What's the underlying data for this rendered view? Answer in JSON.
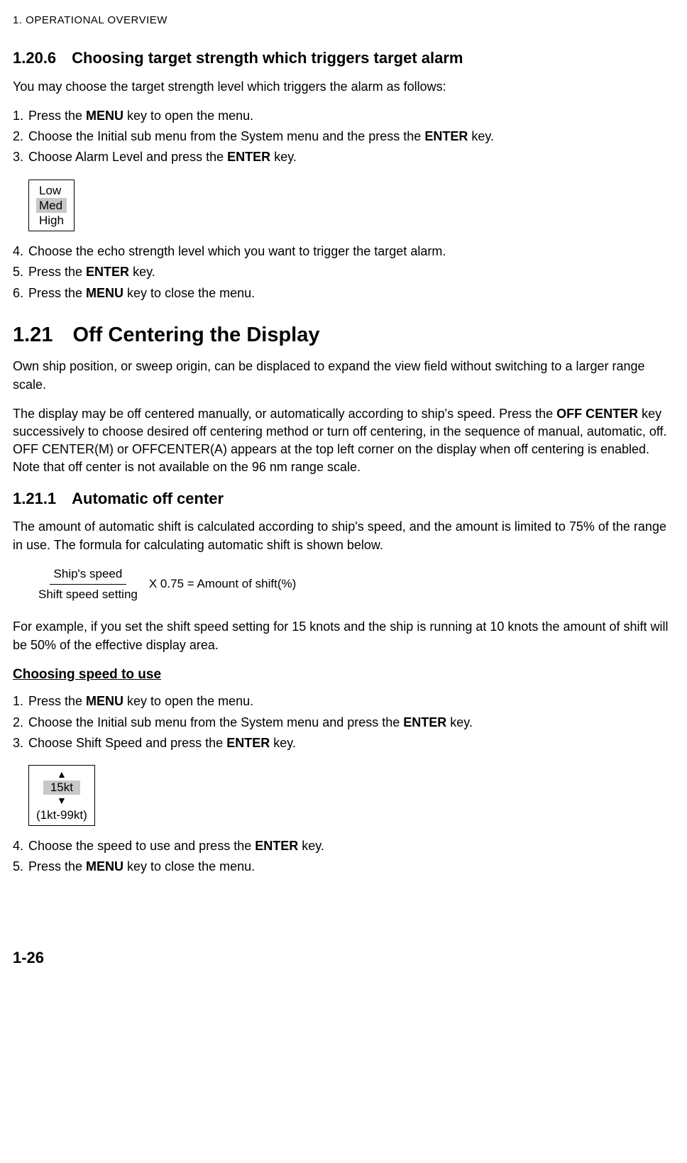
{
  "header": "1. OPERATIONAL OVERVIEW",
  "s1206": {
    "num": "1.20.6",
    "title": "Choosing target strength which triggers target alarm",
    "intro": "You may choose the target strength level which triggers the alarm as follows:",
    "steps_a": [
      {
        "pre": "Press the ",
        "b": "MENU",
        "post": " key to open the menu."
      },
      {
        "pre": "Choose the Initial sub menu from the System menu and the press the ",
        "b": "ENTER",
        "post": " key."
      },
      {
        "pre": "Choose Alarm Level and press the ",
        "b": "ENTER",
        "post": " key."
      }
    ],
    "options": {
      "o1": "Low",
      "o2": "Med",
      "o3": "High"
    },
    "steps_b": [
      {
        "pre": "Choose the echo strength level which you want to trigger the target alarm.",
        "b": "",
        "post": ""
      },
      {
        "pre": "Press the ",
        "b": "ENTER",
        "post": " key."
      },
      {
        "pre": "Press the ",
        "b": "MENU",
        "post": " key to close the menu."
      }
    ]
  },
  "s121": {
    "num": "1.21",
    "title": "Off Centering the Display",
    "p1": "Own ship position, or sweep origin, can be displaced to expand the view field without switching to a larger range scale.",
    "p2a": "The display may be off centered manually, or automatically according to ship's speed. Press the ",
    "p2b": "OFF CENTER",
    "p2c": " key successively to choose desired off centering method or turn off centering, in the sequence of manual, automatic, off. OFF CENTER(M) or OFFCENTER(A) appears at the top left corner on the display when off centering is enabled. Note that off center is not available on the 96 nm range scale."
  },
  "s1211": {
    "num": "1.21.1",
    "title": "Automatic off center",
    "p1": "The amount of automatic shift is calculated according to ship's speed, and the amount is limited to 75% of the range in use. The formula for calculating automatic shift is shown below.",
    "formula": {
      "num": "Ship's speed",
      "den": "Shift speed setting",
      "rest": " X 0.75  =  Amount of shift(%)"
    },
    "p2": "For example, if you set the shift speed setting for 15 knots and the ship is running at 10 knots the amount of shift will be 50% of the effective display area.",
    "subtitle": "Choosing speed to use",
    "steps_a": [
      {
        "pre": "Press the ",
        "b": "MENU",
        "post": " key to open the menu."
      },
      {
        "pre": "Choose the Initial sub menu from the System menu and press the ",
        "b": "ENTER",
        "post": " key."
      },
      {
        "pre": "Choose Shift Speed and press the ",
        "b": "ENTER",
        "post": " key."
      }
    ],
    "spinner": {
      "up": "▲",
      "val": "15kt",
      "down": "▼",
      "range": "(1kt-99kt)"
    },
    "steps_b": [
      {
        "pre": "Choose the speed to use and press the ",
        "b": "ENTER",
        "post": " key."
      },
      {
        "pre": "Press the ",
        "b": "MENU",
        "post": " key to close the menu."
      }
    ]
  },
  "page_num": "1-26"
}
